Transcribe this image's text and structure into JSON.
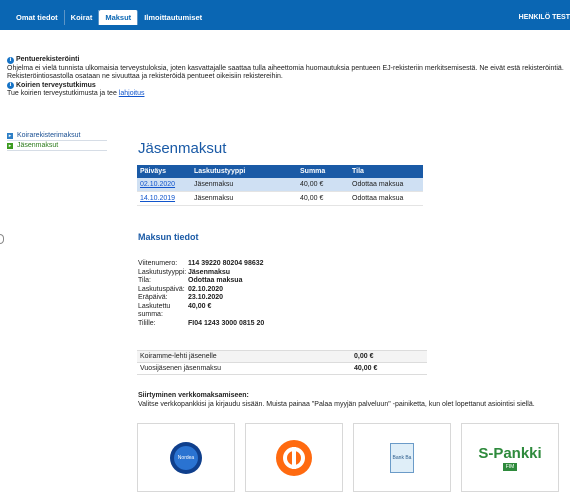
{
  "nav": {
    "tabs": [
      "Omat tiedot",
      "Koirat",
      "Maksut",
      "Ilmoittautumiset"
    ],
    "user": "HENKILÖ TEST"
  },
  "notice": {
    "title1": "Pentuerekisteröinti",
    "text1": "Ohjelma ei vielä tunnista ulkomaisia terveystuloksia, joten kasvattajalle saattaa tulla aiheettomia huomautuksia pentueen EJ-rekisteriin merkitsemisestä. Ne eivät estä rekisteröintiä. Rekisteröintiosastolla osataan ne sivuuttaa ja rekisteröidä pentueet oikeisiin rekistereihin.",
    "title2": "Koirien terveystutkimus",
    "text2_prefix": "Tue koirien terveystutkimusta ja tee",
    "text2_link": "lahjoitus"
  },
  "sidebar": {
    "items": [
      {
        "label": "Koirarekisterimaksut"
      },
      {
        "label": "Jäsenmaksut"
      }
    ]
  },
  "main": {
    "title": "Jäsenmaksut",
    "table": {
      "headers": [
        "Päiväys",
        "Laskutustyyppi",
        "Summa",
        "Tila"
      ],
      "rows": [
        {
          "date": "02.10.2020",
          "type": "Jäsenmaksu",
          "amount": "40,00 €",
          "status": "Odottaa maksua"
        },
        {
          "date": "14.10.2019",
          "type": "Jäsenmaksu",
          "amount": "40,00 €",
          "status": "Odottaa maksua"
        }
      ]
    },
    "details_title": "Maksun tiedot",
    "details": [
      {
        "label": "Viitenumero:",
        "value": "114 39220 80204 98632"
      },
      {
        "label": "Laskutustyyppi:",
        "value": "Jäsenmaksu"
      },
      {
        "label": "Tila:",
        "value": "Odottaa maksua"
      },
      {
        "label": "Laskutuspäivä:",
        "value": "02.10.2020"
      },
      {
        "label": "Eräpäivä:",
        "value": "23.10.2020"
      },
      {
        "label": "Laskutettu summa:",
        "value": "40,00 €"
      },
      {
        "label": "Tilille:",
        "value": "FI04 1243 3000 0815 20"
      }
    ],
    "summary": [
      {
        "label": "Koiramme-lehti jäsenelle",
        "amount": "0,00 €"
      },
      {
        "label": "Vuosijäsenen jäsenmaksu",
        "amount": "40,00 €"
      }
    ],
    "online_title": "Siirtyminen verkkomaksamiseen:",
    "online_text": "Valitse verkkopankkisi ja kirjaudu sisään. Muista painaa \"Palaa myyjän palveluun\" -painiketta, kun olet lopettanut asiointisi siellä."
  },
  "banks": {
    "nordea_label": "Nordea",
    "aktia_label": "Bank Ba",
    "spankki_name": "S-Pankki",
    "spankki_tag": "FIM"
  },
  "colors": {
    "topbar": "#0a66b3",
    "accent": "#1a5aa6",
    "op_orange": "#ff6a10",
    "spankki_green": "#2e8a3c"
  }
}
